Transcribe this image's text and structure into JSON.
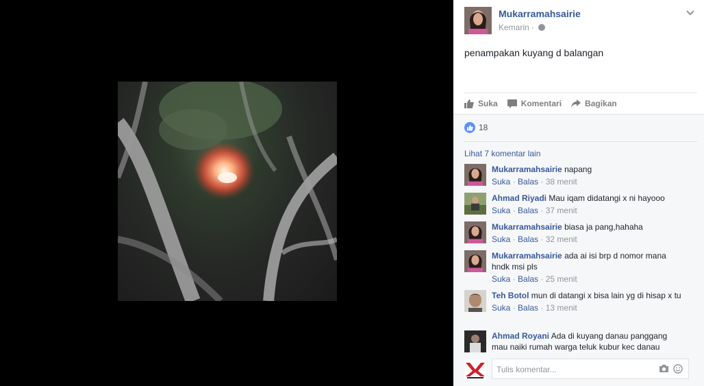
{
  "post": {
    "author": "Mukarramahsairie",
    "time": "Kemarin",
    "text": "penampakan kuyang d balangan"
  },
  "actions": {
    "like": "Suka",
    "comment": "Komentari",
    "share": "Bagikan"
  },
  "reactions": {
    "count": "18"
  },
  "comments_more": "Lihat 7 komentar lain",
  "comments": [
    {
      "name": "Mukarramahsairie",
      "text": "napang",
      "like": "Suka",
      "reply": "Balas",
      "time": "38 menit"
    },
    {
      "name": "Ahmad Riyadi",
      "text": "Mau iqam didatangi x ni hayooo",
      "like": "Suka",
      "reply": "Balas",
      "time": "37 menit"
    },
    {
      "name": "Mukarramahsairie",
      "text": "biasa ja pang,hahaha",
      "like": "Suka",
      "reply": "Balas",
      "time": "32 menit"
    },
    {
      "name": "Mukarramahsairie",
      "text": "ada ai isi brp d nomor mana hndk msi pls",
      "like": "Suka",
      "reply": "Balas",
      "time": "25 menit"
    },
    {
      "name": "Teh Botol",
      "text": "mun di datangi x bisa lain yg di hisap x tu",
      "like": "Suka",
      "reply": "Balas",
      "time": "13 menit"
    },
    {
      "name": "Ahmad Royani",
      "text": "Ada di kuyang danau panggang mau naiki rumah warga teluk kubur kec danau"
    }
  ],
  "composer": {
    "placeholder": "Tulis komentar..."
  },
  "colors": {
    "link": "#365899",
    "meta": "#90949c",
    "like_blue": "#5890ff",
    "ufi_bg": "#f6f7f9"
  }
}
